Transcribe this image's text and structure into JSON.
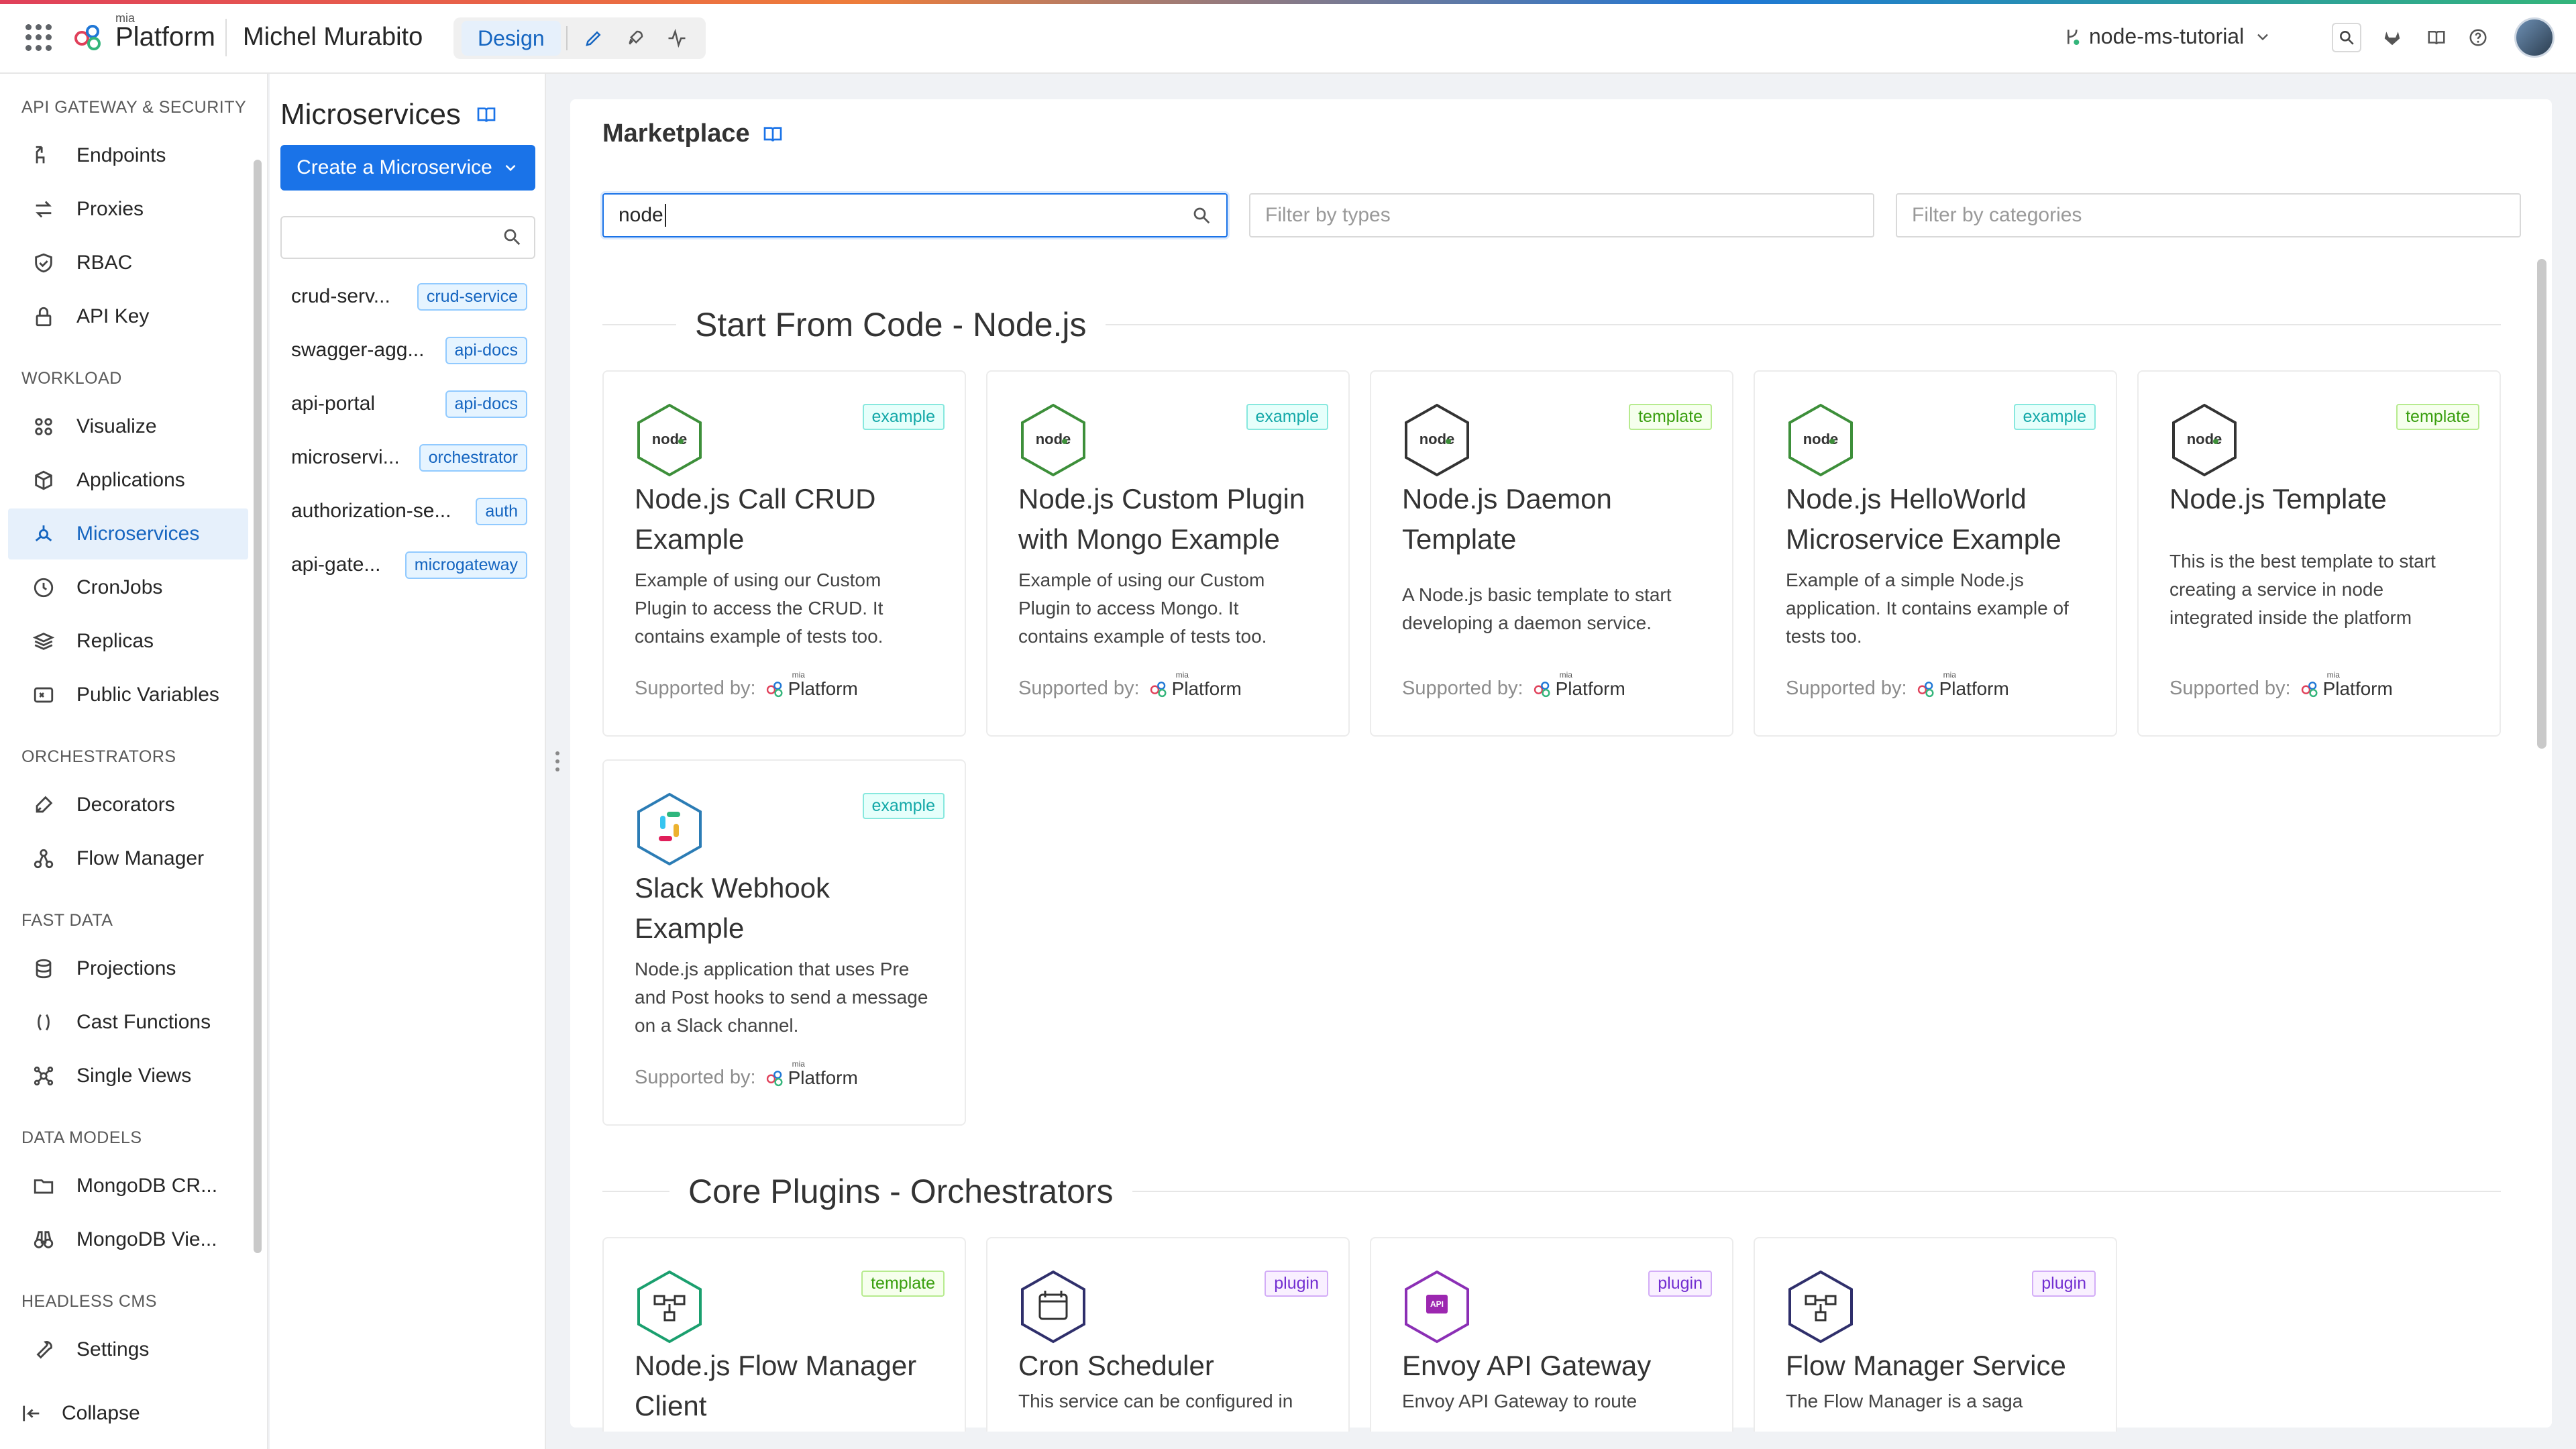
{
  "topbar": {
    "brand_small": "mia",
    "brand": "Platform",
    "user_name": "Michel Murabito",
    "mode_design": "Design",
    "project": "node-ms-tutorial"
  },
  "sidebar": {
    "sections": [
      {
        "title": "API GATEWAY & SECURITY",
        "items": [
          {
            "label": "Endpoints",
            "icon": "endpoints-icon"
          },
          {
            "label": "Proxies",
            "icon": "proxies-icon"
          },
          {
            "label": "RBAC",
            "icon": "shield-icon"
          },
          {
            "label": "API Key",
            "icon": "lock-icon"
          }
        ]
      },
      {
        "title": "WORKLOAD",
        "items": [
          {
            "label": "Visualize",
            "icon": "visualize-icon"
          },
          {
            "label": "Applications",
            "icon": "cube-icon"
          },
          {
            "label": "Microservices",
            "icon": "microservices-icon",
            "active": true
          },
          {
            "label": "CronJobs",
            "icon": "clock-icon"
          },
          {
            "label": "Replicas",
            "icon": "layers-icon"
          },
          {
            "label": "Public Variables",
            "icon": "variables-icon"
          }
        ]
      },
      {
        "title": "ORCHESTRATORS",
        "items": [
          {
            "label": "Decorators",
            "icon": "brush-icon"
          },
          {
            "label": "Flow Manager",
            "icon": "flow-icon"
          }
        ]
      },
      {
        "title": "FAST DATA",
        "items": [
          {
            "label": "Projections",
            "icon": "database-icon"
          },
          {
            "label": "Cast Functions",
            "icon": "parentheses-icon"
          },
          {
            "label": "Single Views",
            "icon": "graph-icon"
          }
        ]
      },
      {
        "title": "DATA MODELS",
        "items": [
          {
            "label": "MongoDB CR...",
            "icon": "folder-icon"
          },
          {
            "label": "MongoDB Vie...",
            "icon": "binoculars-icon"
          }
        ]
      },
      {
        "title": "HEADLESS CMS",
        "items": [
          {
            "label": "Settings",
            "icon": "wrench-icon"
          }
        ]
      }
    ],
    "collapse_label": "Collapse"
  },
  "microservices_panel": {
    "title": "Microservices",
    "create_button": "Create a Microservice",
    "search_value": "",
    "items": [
      {
        "name": "crud-serv...",
        "tag": "crud-service"
      },
      {
        "name": "swagger-agg...",
        "tag": "api-docs"
      },
      {
        "name": "api-portal",
        "tag": "api-docs"
      },
      {
        "name": "microservi...",
        "tag": "orchestrator"
      },
      {
        "name": "authorization-se...",
        "tag": "auth"
      },
      {
        "name": "api-gate...",
        "tag": "microgateway"
      }
    ]
  },
  "marketplace": {
    "title": "Marketplace",
    "search_value": "node",
    "filter_types_placeholder": "Filter by types",
    "filter_categories_placeholder": "Filter by categories",
    "supported_by_label": "Supported by:",
    "supporter_small": "mia",
    "supporter": "Platform",
    "sections": [
      {
        "title": "Start From Code - Node.js",
        "cards": [
          {
            "title": "Node.js Call CRUD Example",
            "tag": "example",
            "icon": "nodejs-icon",
            "description": "Example of using our Custom Plugin to access the CRUD. It contains example of tests too."
          },
          {
            "title": "Node.js Custom Plugin with Mongo Example",
            "tag": "example",
            "icon": "nodejs-icon",
            "description": "Example of using our Custom Plugin to access Mongo. It contains example of tests too."
          },
          {
            "title": "Node.js Daemon Template",
            "tag": "template",
            "icon": "nodejs-icon",
            "description": "A Node.js basic template to start developing a daemon service."
          },
          {
            "title": "Node.js HelloWorld Microservice Example",
            "tag": "example",
            "icon": "nodejs-icon",
            "description": "Example of a simple Node.js application. It contains example of tests too."
          },
          {
            "title": "Node.js Template",
            "tag": "template",
            "icon": "nodejs-icon",
            "description": "This is the best template to start creating a service in node integrated inside the platform"
          },
          {
            "title": "Slack Webhook Example",
            "tag": "example",
            "icon": "slack-icon",
            "description": "Node.js application that uses Pre and Post hooks to send a message on a Slack channel."
          }
        ]
      },
      {
        "title": "Core Plugins - Orchestrators",
        "cards": [
          {
            "title": "Node.js Flow Manager Client",
            "tag": "template",
            "icon": "flow-manager-client-icon",
            "description": ""
          },
          {
            "title": "Cron Scheduler",
            "tag": "plugin",
            "icon": "calendar-icon",
            "description": "This service can be configured in"
          },
          {
            "title": "Envoy API Gateway",
            "tag": "plugin",
            "icon": "api-gateway-icon",
            "description": "Envoy API Gateway to route"
          },
          {
            "title": "Flow Manager Service",
            "tag": "plugin",
            "icon": "flow-manager-icon",
            "description": "The Flow Manager is a saga"
          }
        ]
      }
    ]
  },
  "colors": {
    "accent": "#1a73e8",
    "active_bg": "#e6f0fb",
    "node_green": "#3d8f3a"
  }
}
